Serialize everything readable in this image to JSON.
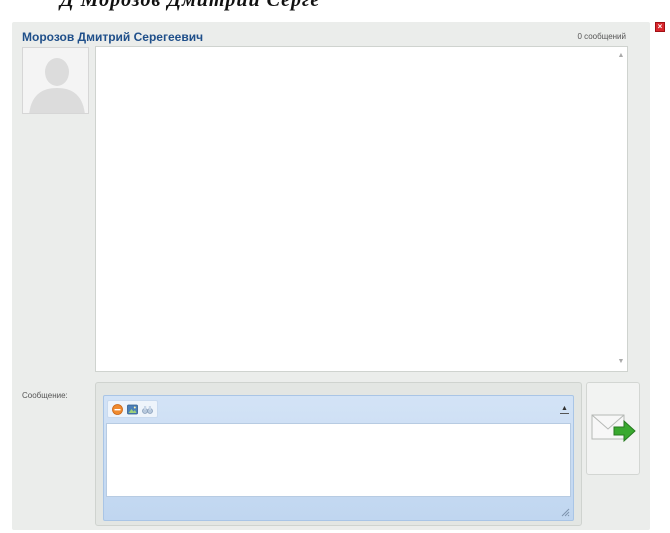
{
  "header": {
    "cut_title": "Д Морозов Дмитрий Серге"
  },
  "chat": {
    "contact_name": "Морозов Дмитрий Серегеевич",
    "message_count": "0 сообщений",
    "history_messages": []
  },
  "composer": {
    "label": "Сообщение:",
    "value": "",
    "placeholder": "",
    "toolbar_icons": [
      "smiley-icon",
      "image-icon",
      "binoculars-icon"
    ]
  },
  "colors": {
    "panel_bg": "#ebedeb",
    "name_blue": "#1f4f8a",
    "editor_blue": "#c0d6f0",
    "close_red": "#d9262c",
    "send_green": "#39a92f"
  }
}
